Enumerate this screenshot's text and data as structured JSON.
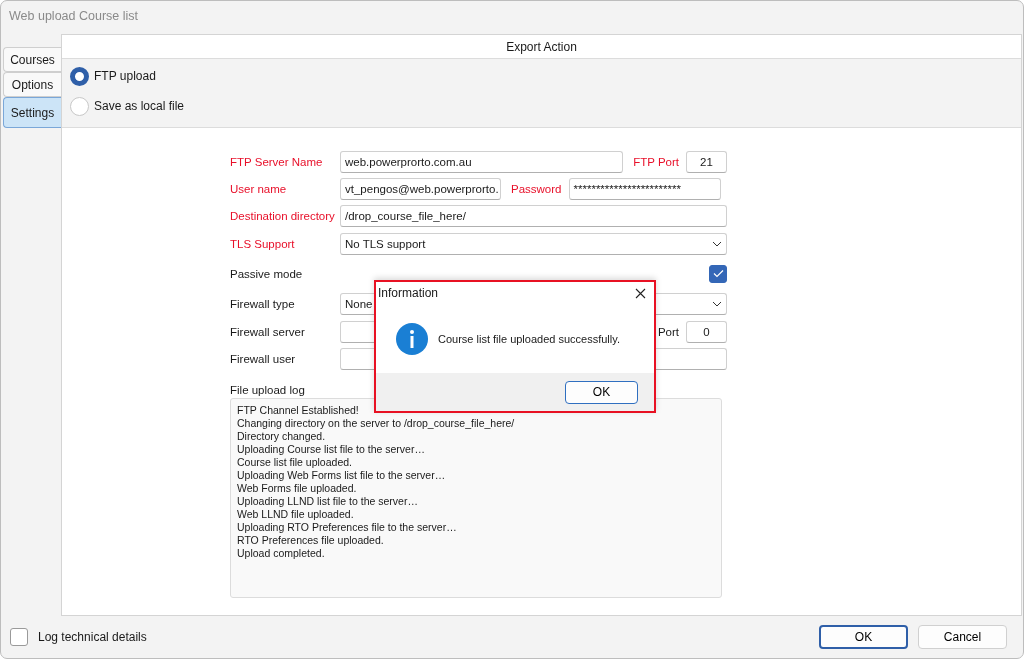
{
  "window": {
    "title": "Web upload Course list"
  },
  "tabs": [
    {
      "label": "Courses",
      "selected": false
    },
    {
      "label": "Options",
      "selected": false
    },
    {
      "label": "Settings",
      "selected": true
    }
  ],
  "export_action": {
    "title": "Export Action",
    "options": [
      {
        "label": "FTP upload",
        "selected": true
      },
      {
        "label": "Save as local file",
        "selected": false
      }
    ]
  },
  "fields": [
    {
      "kind": "text",
      "label": "FTP Server Name",
      "required": true,
      "value": "web.powerprorto.com.au",
      "extra": {
        "label": "FTP Port",
        "required": true,
        "value": "21"
      }
    },
    {
      "kind": "login",
      "label": "User name",
      "required": true,
      "value": "vt_pengos@web.powerprorto.",
      "extra": {
        "label": "Password",
        "required": true,
        "value": "************************"
      }
    },
    {
      "kind": "text",
      "label": "Destination directory",
      "required": true,
      "value": "/drop_course_file_here/"
    },
    {
      "kind": "select",
      "label": "TLS Support",
      "required": true,
      "value": "No TLS support"
    },
    {
      "kind": "checkbox",
      "label": "Passive mode",
      "required": false,
      "checked": true
    },
    {
      "kind": "select",
      "label": "Firewall type",
      "required": false,
      "value": "None"
    },
    {
      "kind": "text",
      "label": "Firewall server",
      "required": false,
      "extra": {
        "label": "Port",
        "required": false,
        "value": "0"
      }
    },
    {
      "kind": "text",
      "label": "Firewall user",
      "required": false
    }
  ],
  "log": {
    "title": "File upload log",
    "lines": [
      "FTP Channel Established!",
      "Changing directory on the server to /drop_course_file_here/",
      "Directory changed.",
      "Uploading Course list file to the server…",
      "Course list file uploaded.",
      "Uploading Web Forms list file to the server…",
      "Web Forms file uploaded.",
      "Uploading LLND list file to the server…",
      "Web LLND file uploaded.",
      "Uploading RTO Preferences file to the server…",
      "RTO Preferences file uploaded.",
      "Upload completed."
    ]
  },
  "dialog": {
    "title": "Information",
    "message": "Course list file uploaded successfully.",
    "button": "OK"
  },
  "footer": {
    "log_technical_details": {
      "label": "Log technical details",
      "checked": false
    },
    "buttons": [
      {
        "label": "OK",
        "default": true
      },
      {
        "label": "Cancel",
        "default": false
      }
    ]
  }
}
